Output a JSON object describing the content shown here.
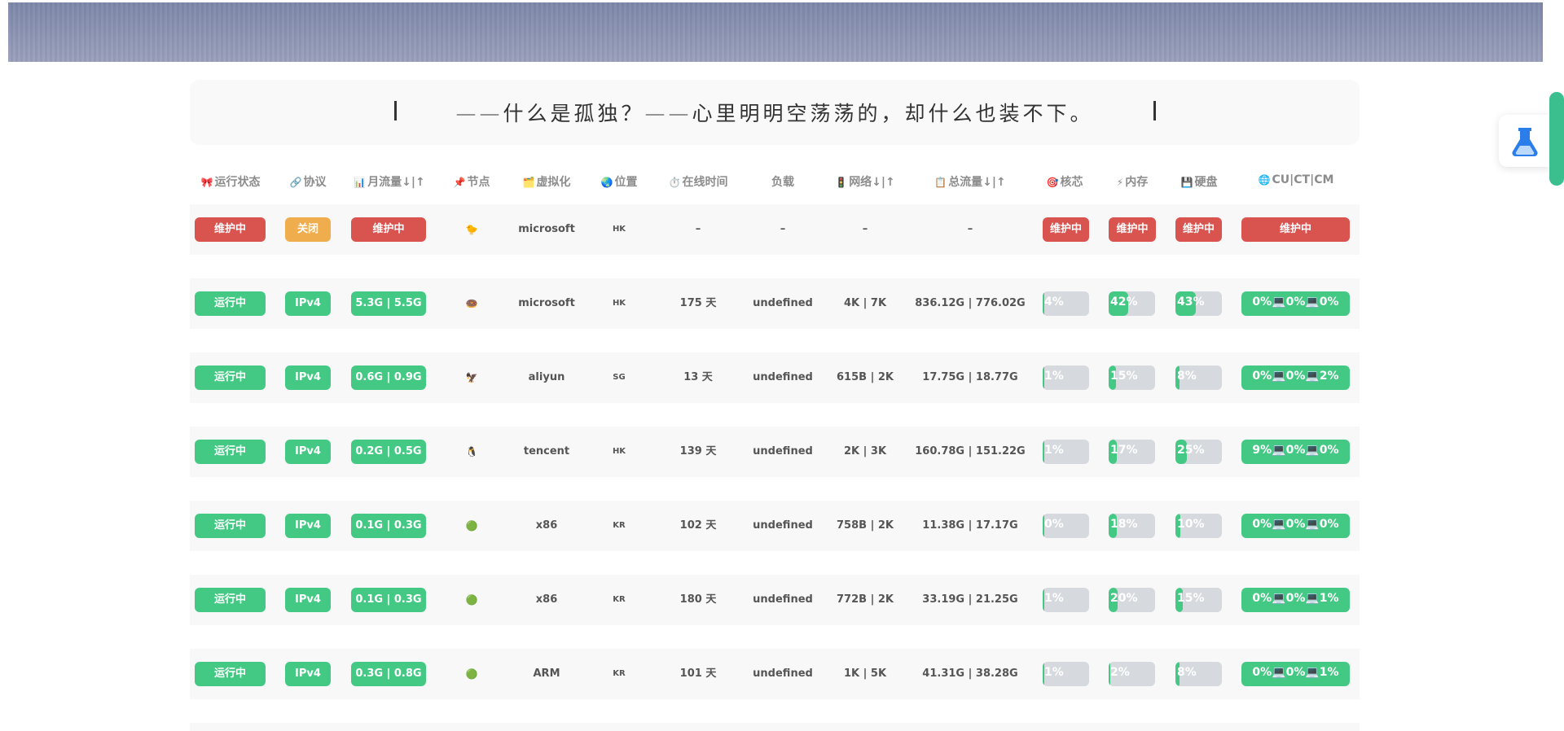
{
  "quote": "——什么是孤独？——心里明明空荡荡的，却什么也装不下。",
  "headers": [
    {
      "icon": "🎀",
      "label": "运行状态"
    },
    {
      "icon": "🔗",
      "label": "协议"
    },
    {
      "icon": "📊",
      "label": "月流量↓|↑"
    },
    {
      "icon": "📌",
      "label": "节点"
    },
    {
      "icon": "🗂️",
      "label": "虚拟化"
    },
    {
      "icon": "🌏",
      "label": "位置"
    },
    {
      "icon": "⏱️",
      "label": "在线时间"
    },
    {
      "icon": "",
      "label": "负载"
    },
    {
      "icon": "🚦",
      "label": "网络↓|↑"
    },
    {
      "icon": "📋",
      "label": "总流量↓|↑"
    },
    {
      "icon": "🎯",
      "label": "核芯"
    },
    {
      "icon": "⚡",
      "label": "内存"
    },
    {
      "icon": "💾",
      "label": "硬盘"
    },
    {
      "icon": "🌐",
      "label": "CU|CT|CM"
    }
  ],
  "rows": [
    {
      "status": "维护中",
      "status_color": "red",
      "protocol": "关闭",
      "protocol_color": "orange",
      "monthly": "维护中",
      "monthly_color": "red",
      "node_icon": "🐤",
      "virt": "microsoft",
      "loc": "HK",
      "uptime": "–",
      "load": "–",
      "network": "–",
      "total": "–",
      "maintenance": true,
      "cpu_label": "维护中",
      "mem_label": "维护中",
      "disk_label": "维护中",
      "ping_label": "维护中"
    },
    {
      "status": "运行中",
      "status_color": "green",
      "protocol": "IPv4",
      "protocol_color": "green",
      "monthly": "5.3G | 5.5G",
      "monthly_color": "green",
      "node_icon": "🍩",
      "virt": "microsoft",
      "loc": "HK",
      "uptime": "175 天",
      "load": "undefined",
      "network": "4K | 7K",
      "total": "836.12G | 776.02G",
      "maintenance": false,
      "cpu": 4,
      "cpu_label": "4%",
      "mem": 42,
      "mem_label": "42%",
      "disk": 43,
      "disk_label": "43%",
      "ping_label": "0%💻0%💻0%"
    },
    {
      "status": "运行中",
      "status_color": "green",
      "protocol": "IPv4",
      "protocol_color": "green",
      "monthly": "0.6G | 0.9G",
      "monthly_color": "green",
      "node_icon": "🦅",
      "virt": "aliyun",
      "loc": "SG",
      "uptime": "13 天",
      "load": "undefined",
      "network": "615B | 2K",
      "total": "17.75G | 18.77G",
      "maintenance": false,
      "cpu": 1,
      "cpu_label": "1%",
      "mem": 15,
      "mem_label": "15%",
      "disk": 8,
      "disk_label": "8%",
      "ping_label": "0%💻0%💻2%"
    },
    {
      "status": "运行中",
      "status_color": "green",
      "protocol": "IPv4",
      "protocol_color": "green",
      "monthly": "0.2G | 0.5G",
      "monthly_color": "green",
      "node_icon": "🐧",
      "virt": "tencent",
      "loc": "HK",
      "uptime": "139 天",
      "load": "undefined",
      "network": "2K | 3K",
      "total": "160.78G | 151.22G",
      "maintenance": false,
      "cpu": 1,
      "cpu_label": "1%",
      "mem": 17,
      "mem_label": "17%",
      "disk": 25,
      "disk_label": "25%",
      "ping_label": "9%💻0%💻0%"
    },
    {
      "status": "运行中",
      "status_color": "green",
      "protocol": "IPv4",
      "protocol_color": "green",
      "monthly": "0.1G | 0.3G",
      "monthly_color": "green",
      "node_icon": "🟢",
      "virt": "x86",
      "loc": "KR",
      "uptime": "102 天",
      "load": "undefined",
      "network": "758B | 2K",
      "total": "11.38G | 17.17G",
      "maintenance": false,
      "cpu": 0,
      "cpu_label": "0%",
      "mem": 18,
      "mem_label": "18%",
      "disk": 10,
      "disk_label": "10%",
      "ping_label": "0%💻0%💻0%"
    },
    {
      "status": "运行中",
      "status_color": "green",
      "protocol": "IPv4",
      "protocol_color": "green",
      "monthly": "0.1G | 0.3G",
      "monthly_color": "green",
      "node_icon": "🟢",
      "virt": "x86",
      "loc": "KR",
      "uptime": "180 天",
      "load": "undefined",
      "network": "772B | 2K",
      "total": "33.19G | 21.25G",
      "maintenance": false,
      "cpu": 1,
      "cpu_label": "1%",
      "mem": 20,
      "mem_label": "20%",
      "disk": 15,
      "disk_label": "15%",
      "ping_label": "0%💻0%💻1%"
    },
    {
      "status": "运行中",
      "status_color": "green",
      "protocol": "IPv4",
      "protocol_color": "green",
      "monthly": "0.3G | 0.8G",
      "monthly_color": "green",
      "node_icon": "🟢",
      "virt": "ARM",
      "loc": "KR",
      "uptime": "101 天",
      "load": "undefined",
      "network": "1K | 5K",
      "total": "41.31G | 38.28G",
      "maintenance": false,
      "cpu": 1,
      "cpu_label": "1%",
      "mem": 2,
      "mem_label": "2%",
      "disk": 8,
      "disk_label": "8%",
      "ping_label": "0%💻0%💻1%"
    }
  ],
  "flask_icon": "flask-icon"
}
